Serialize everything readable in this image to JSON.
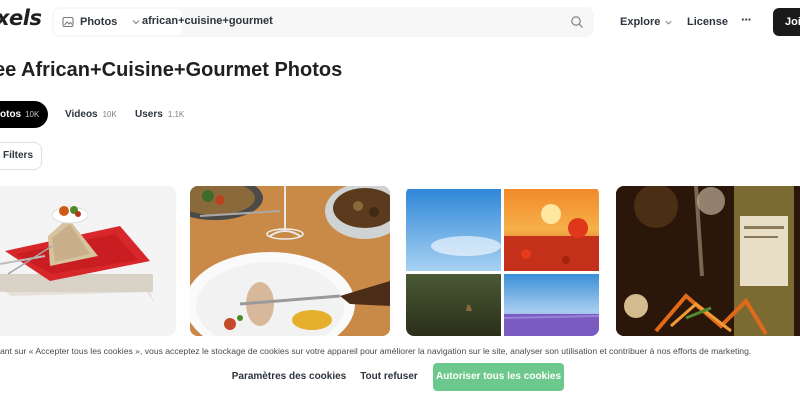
{
  "header": {
    "logo_text": "xels",
    "search": {
      "type_label": "Photos",
      "value": "african+cuisine+gourmet"
    },
    "nav": {
      "explore": "Explore",
      "license": "License",
      "more": "···",
      "join": "Join"
    }
  },
  "page_title": "ee African+Cuisine+Gourmet Photos",
  "tabs": [
    {
      "label": "otos",
      "count": "10K",
      "active": true
    },
    {
      "label": "Videos",
      "count": "10K"
    },
    {
      "label": "Users",
      "count": "1.1K"
    }
  ],
  "filters_label": "Filters",
  "photos": [
    {
      "name": "african-dish-on-red-plate"
    },
    {
      "name": "dinner-table-with-wine"
    },
    {
      "name": "nature-collection-collage"
    },
    {
      "name": "bokeh-gourmet-plate-with-wine"
    }
  ],
  "cookie_banner": {
    "text": "ant sur « Accepter tous les cookies », vous acceptez le stockage de cookies sur votre appareil pour améliorer la navigation sur le site, analyser son utilisation et contribuer à nos efforts de marketing.",
    "settings_label": "Paramètres des cookies",
    "refuse_label": "Tout refuser",
    "accept_label": "Autoriser tous les cookies"
  },
  "colors": {
    "accent_green": "#6dc88d",
    "dark_button": "#1a1a1a"
  }
}
